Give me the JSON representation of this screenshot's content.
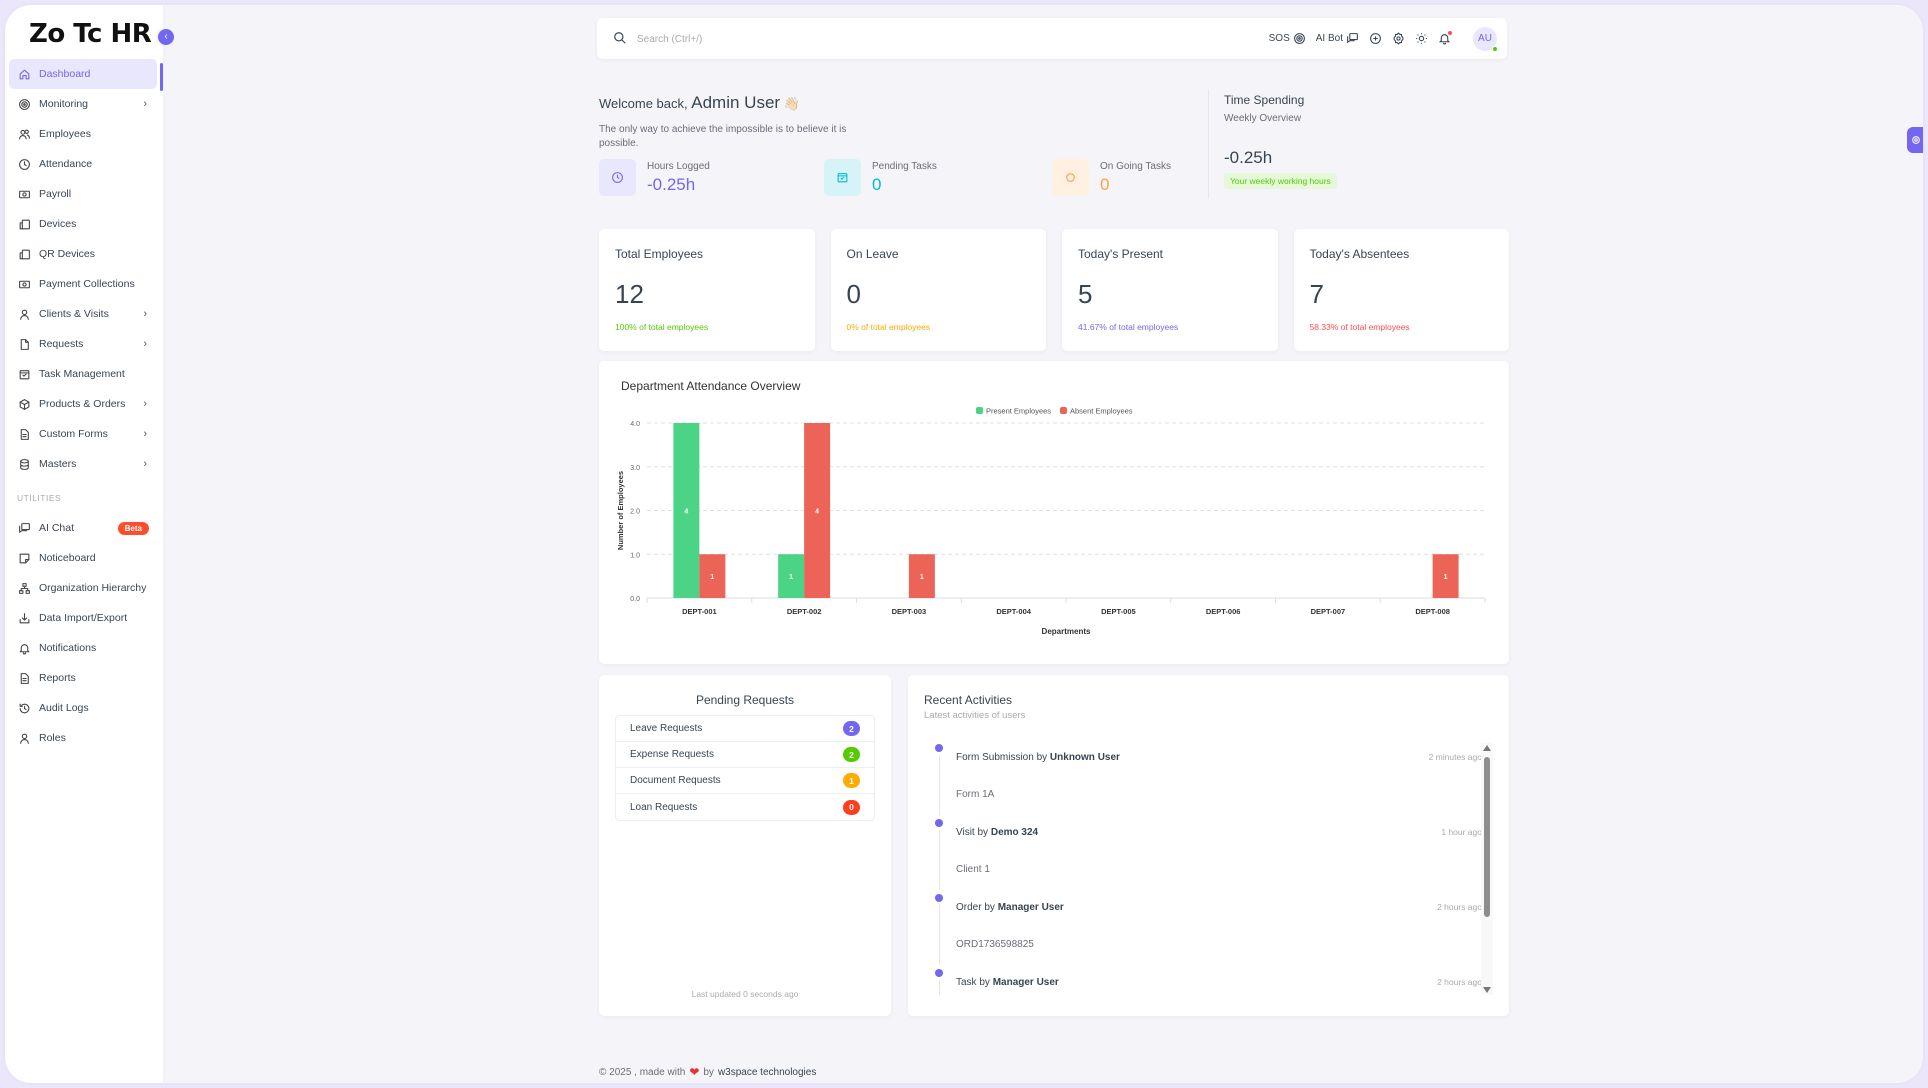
{
  "app": {
    "brand": "Zo Tc HR"
  },
  "sidebar": {
    "items": [
      {
        "label": "Dashboard",
        "icon": "home-icon",
        "active": true,
        "has_submenu": false
      },
      {
        "label": "Monitoring",
        "icon": "target-icon",
        "has_submenu": true
      },
      {
        "label": "Employees",
        "icon": "users-icon",
        "has_submenu": false
      },
      {
        "label": "Attendance",
        "icon": "clock-icon",
        "has_submenu": false
      },
      {
        "label": "Payroll",
        "icon": "cash-icon",
        "has_submenu": false
      },
      {
        "label": "Devices",
        "icon": "devices-icon",
        "has_submenu": false
      },
      {
        "label": "QR Devices",
        "icon": "devices-icon",
        "has_submenu": false
      },
      {
        "label": "Payment Collections",
        "icon": "cash-icon",
        "has_submenu": false
      },
      {
        "label": "Clients & Visits",
        "icon": "user-icon",
        "has_submenu": true
      },
      {
        "label": "Requests",
        "icon": "file-icon",
        "has_submenu": true
      },
      {
        "label": "Task Management",
        "icon": "calendar-check-icon",
        "has_submenu": false
      },
      {
        "label": "Products & Orders",
        "icon": "package-icon",
        "has_submenu": true
      },
      {
        "label": "Custom Forms",
        "icon": "file-text-icon",
        "has_submenu": true
      },
      {
        "label": "Masters",
        "icon": "database-icon",
        "has_submenu": true
      }
    ],
    "section_label": "UTILITIES",
    "utilities": [
      {
        "label": "AI Chat",
        "icon": "messages-icon",
        "badge": "Beta"
      },
      {
        "label": "Noticeboard",
        "icon": "sticker-icon"
      },
      {
        "label": "Organization Hierarchy",
        "icon": "hierarchy-icon"
      },
      {
        "label": "Data Import/Export",
        "icon": "download-icon"
      },
      {
        "label": "Notifications",
        "icon": "bell-icon"
      },
      {
        "label": "Reports",
        "icon": "file-text-icon"
      },
      {
        "label": "Audit Logs",
        "icon": "history-icon"
      },
      {
        "label": "Roles",
        "icon": "user-icon"
      }
    ]
  },
  "topbar": {
    "search_placeholder": "Search (Ctrl+/)",
    "sos_label": "SOS",
    "aibot_label": "AI Bot",
    "avatar_initials": "AU"
  },
  "welcome": {
    "greeting": "Welcome back,",
    "user_name": "Admin User",
    "emoji": "👋🏻",
    "quote": "The only way to achieve the impossible is to believe it is possible.",
    "stats": [
      {
        "label": "Hours Logged",
        "value": "-0.25h",
        "color": "#7367f0",
        "bg": "#e9e7fd"
      },
      {
        "label": "Pending Tasks",
        "value": "0",
        "color": "#00bad1",
        "bg": "#d6f4f8"
      },
      {
        "label": "On Going Tasks",
        "value": "0",
        "color": "#ff9f43",
        "bg": "#fff0e1"
      }
    ]
  },
  "time_spending": {
    "title": "Time Spending",
    "subtitle": "Weekly Overview",
    "value": "-0.25h",
    "badge": "Your weekly working hours"
  },
  "stat_cards": [
    {
      "title": "Total Employees",
      "value": "12",
      "footer": "100% of total employees",
      "color": "#56ca00"
    },
    {
      "title": "On Leave",
      "value": "0",
      "footer": "0% of total employees",
      "color": "#ffab00"
    },
    {
      "title": "Today's Present",
      "value": "5",
      "footer": "41.67% of total employees",
      "color": "#7367f0"
    },
    {
      "title": "Today's Absentees",
      "value": "7",
      "footer": "58.33% of total employees",
      "color": "#ff4c51"
    }
  ],
  "chart_data": {
    "type": "bar",
    "title": "Department Attendance Overview",
    "xlabel": "Departments",
    "ylabel": "Number of Employees",
    "categories": [
      "DEPT-001",
      "DEPT-002",
      "DEPT-003",
      "DEPT-004",
      "DEPT-005",
      "DEPT-006",
      "DEPT-007",
      "DEPT-008"
    ],
    "series": [
      {
        "name": "Present Employees",
        "color": "#4cd486",
        "values": [
          4,
          1,
          0,
          0,
          0,
          0,
          0,
          0
        ]
      },
      {
        "name": "Absent Employees",
        "color": "#ec6357",
        "values": [
          1,
          4,
          1,
          0,
          0,
          0,
          0,
          1
        ]
      }
    ],
    "ylim": [
      0,
      4
    ],
    "yticks": [
      "0.0",
      "1.0",
      "2.0",
      "3.0",
      "4.0"
    ],
    "grid": true,
    "legend": "top-center"
  },
  "pending_requests": {
    "title": "Pending Requests",
    "items": [
      {
        "label": "Leave Requests",
        "count": "2",
        "color": "#7367f0"
      },
      {
        "label": "Expense Requests",
        "count": "2",
        "color": "#56ca00"
      },
      {
        "label": "Document Requests",
        "count": "1",
        "color": "#ffab00"
      },
      {
        "label": "Loan Requests",
        "count": "0",
        "color": "#ff3e1d"
      }
    ],
    "footer": "Last updated 0 seconds ago"
  },
  "recent_activities": {
    "title": "Recent Activities",
    "subtitle": "Latest activities of users",
    "items": [
      {
        "action": "Form Submission by",
        "user": "Unknown User",
        "time": "2 minutes ago",
        "detail": "Form 1A"
      },
      {
        "action": "Visit by",
        "user": "Demo 324",
        "time": "1 hour ago",
        "detail": "Client 1"
      },
      {
        "action": "Order by",
        "user": "Manager User",
        "time": "2 hours ago",
        "detail": "ORD1736598825"
      },
      {
        "action": "Task by",
        "user": "Manager User",
        "time": "2 hours ago",
        "detail": ""
      }
    ]
  },
  "footer": {
    "prefix": "© 2025 , made with",
    "heart": "❤",
    "by": "by",
    "company": "w3space technologies"
  }
}
